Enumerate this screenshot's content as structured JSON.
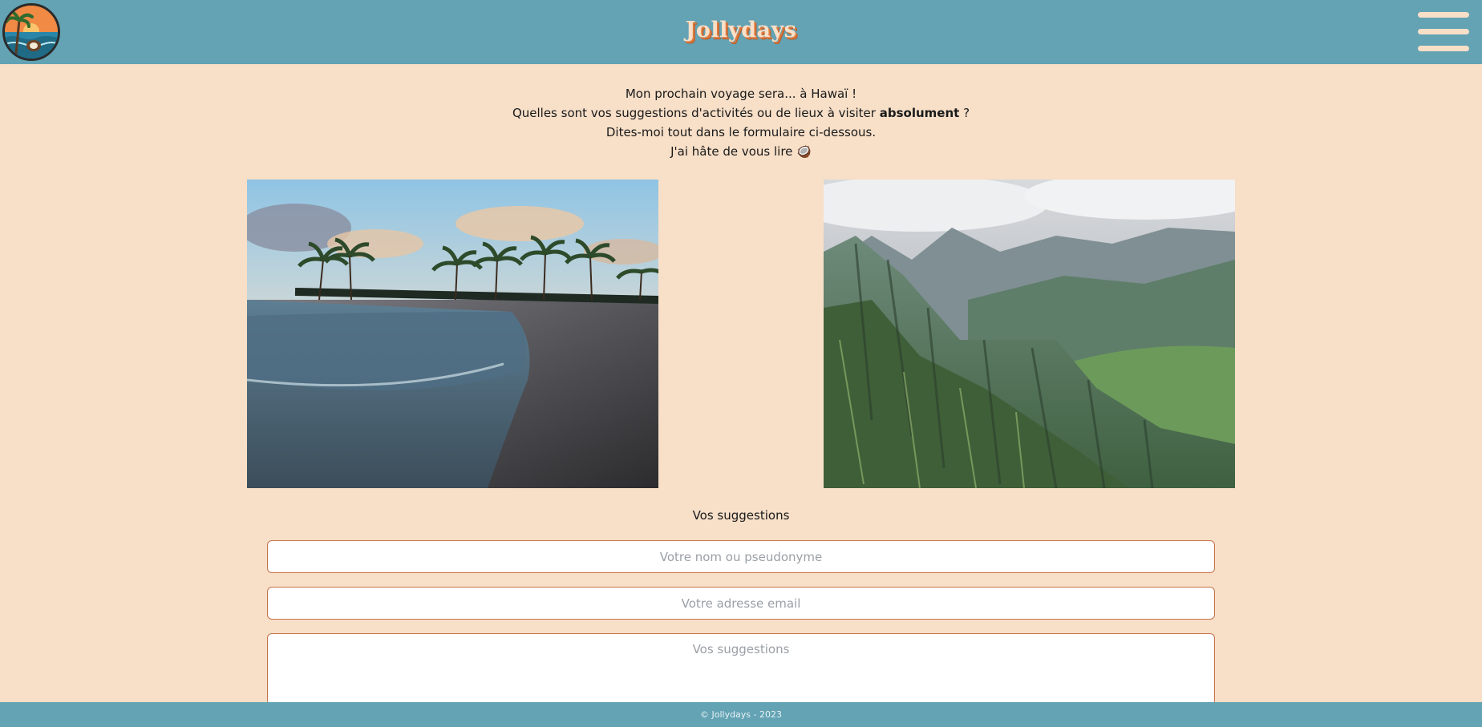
{
  "header": {
    "logo_icon": "palm-beach-coconut-logo",
    "title": "Jollydays",
    "menu_icon": "hamburger-menu-icon"
  },
  "intro": {
    "line1": "Mon prochain voyage sera... à Hawaï !",
    "line2_before": "Quelles sont vos suggestions d'activités ou de lieux à visiter ",
    "line2_bold": "absolument",
    "line2_after": " ?",
    "line3": "Dites-moi tout dans le formulaire ci-dessous.",
    "line4": "J'ai hâte de vous lire",
    "line4_emoji": "🥥"
  },
  "images": {
    "left": "beach-with-palm-trees-sunset",
    "right": "green-mountain-ridges-valley"
  },
  "form": {
    "title": "Vos suggestions",
    "name_placeholder": "Votre nom ou pseudonyme",
    "email_placeholder": "Votre adresse email",
    "suggestions_placeholder": "Vos suggestions"
  },
  "footer": {
    "text": "© Jollydays - 2023"
  },
  "colors": {
    "header_bg": "#63a3b4",
    "page_bg": "#f7dfc8",
    "accent": "#e07a3c",
    "field_border": "#c8734a"
  }
}
